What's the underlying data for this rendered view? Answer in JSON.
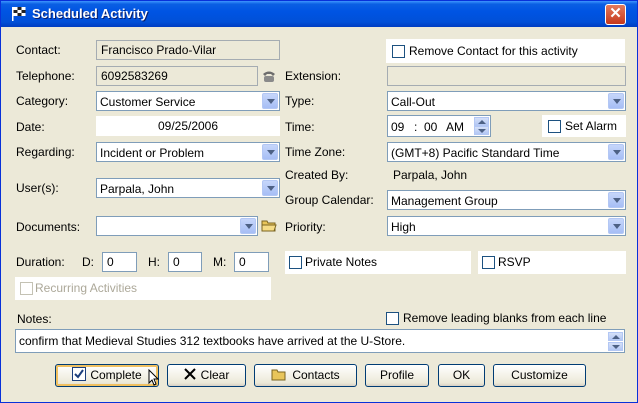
{
  "window": {
    "title": "Scheduled Activity",
    "close_glyph": "✕"
  },
  "contact": {
    "label": "Contact:",
    "value": "Francisco Prado-Vilar"
  },
  "remove_contact": {
    "label": "Remove Contact for this activity",
    "checked": false
  },
  "telephone": {
    "label": "Telephone:",
    "value": "6092583269"
  },
  "extension": {
    "label": "Extension:",
    "value": ""
  },
  "category": {
    "label": "Category:",
    "value": "Customer Service"
  },
  "type": {
    "label": "Type:",
    "value": "Call-Out"
  },
  "date": {
    "label": "Date:",
    "value": "09/25/2006"
  },
  "time": {
    "label": "Time:",
    "hour": "09",
    "sep": ":",
    "minute": "00",
    "ampm": "AM"
  },
  "set_alarm": {
    "label": "Set Alarm",
    "checked": false
  },
  "regarding": {
    "label": "Regarding:",
    "value": "Incident or Problem"
  },
  "timezone": {
    "label": "Time Zone:",
    "value": "(GMT+8) Pacific Standard Time"
  },
  "created_by": {
    "label": "Created By:",
    "value": "Parpala, John"
  },
  "users": {
    "label": "User(s):",
    "value": "Parpala, John"
  },
  "group_calendar": {
    "label": "Group Calendar:",
    "value": "Management Group"
  },
  "documents": {
    "label": "Documents:",
    "value": ""
  },
  "priority": {
    "label": "Priority:",
    "value": "High"
  },
  "duration": {
    "label": "Duration:",
    "d_label": "D:",
    "d_value": "0",
    "h_label": "H:",
    "h_value": "0",
    "m_label": "M:",
    "m_value": "0"
  },
  "private_notes": {
    "label": "Private Notes",
    "checked": false
  },
  "rsvp": {
    "label": "RSVP",
    "checked": false
  },
  "recurring": {
    "label": "Recurring Activities",
    "checked": false,
    "enabled": false
  },
  "notes": {
    "label": "Notes:",
    "remove_blanks_label": "Remove leading blanks from each line",
    "text": "confirm that Medieval Studies 312 textbooks have arrived at the U-Store."
  },
  "buttons": {
    "complete": "Complete",
    "clear": "Clear",
    "contacts": "Contacts",
    "profile": "Profile",
    "ok": "OK",
    "customize": "Customize"
  },
  "icons": {
    "title": "checkered-flag-icon",
    "phone": "phone-icon",
    "folder": "folder-icon",
    "check": "checkmark-icon",
    "x": "x-mark-icon",
    "cursor": "mouse-pointer-icon"
  },
  "colors": {
    "titlebar": "#0054e3",
    "window_bg": "#ece9d8",
    "field_border": "#7f9db9",
    "close_button": "#c6381c"
  }
}
